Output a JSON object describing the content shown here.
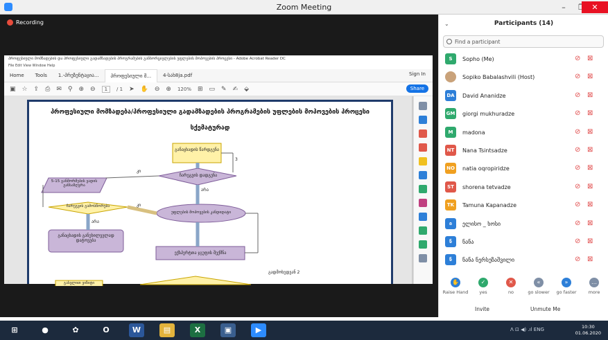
{
  "window": {
    "title": "Zoom Meeting",
    "minimize": "–",
    "maximize": "❐",
    "close": "✕"
  },
  "recording": {
    "label": "Recording"
  },
  "acrobat": {
    "title": "პროფესიული მომზადების და პროფესიული გადამზადების პროგრამების განხორციელების უფლების მოპოვების პროცესი - Adobe Acrobat Reader DC",
    "menu": "File  Edit  View  Window  Help",
    "tabs": [
      "Home",
      "Tools",
      "1.-პრეზენტაცია...",
      "პროფესიული მ...",
      "4-სახ8ja.pdf"
    ],
    "active_tab_index": 3,
    "sign_in": "Sign In",
    "page_current": "1",
    "page_total": "/ 1",
    "zoom": "120%",
    "share_label": "Share"
  },
  "document": {
    "heading_line1": "პროფესიული მომზადება/პროფესიული გადამზადების პროგრამების უფლების მოპოვების პროცესი",
    "heading_line2": "სქემატურად",
    "nodes": {
      "start": "განაცხადის წარდგენა",
      "check": "ჩარეგვის დადგენა",
      "missing": "5-15 განმორმების ვადის განსაზღვრა",
      "review": "ჩარეგვის გამოსწორება",
      "process": "უფლების მოპოვების კანდიდატი",
      "return": "განაცხადის განუხილველად დატოვება",
      "expert": "ექსპერტთა ჯგუფის შექმნა",
      "visit": "გასვლით ვიზიტი",
      "label_yes1": "კი",
      "label_no1": "არა",
      "label_yes2": "კი",
      "label_no2": "არა",
      "label_3": "3",
      "side_note": "გადმოხედვან 2"
    }
  },
  "participants": {
    "title": "Participants (14)",
    "search_placeholder": "Find a participant",
    "list": [
      {
        "initials": "S",
        "name": "Sopho (Me)",
        "color": "#2fa96d"
      },
      {
        "initials": "",
        "name": "Sopiko Babalashvili (Host)",
        "color": "#c9a27a"
      },
      {
        "initials": "DA",
        "name": "David Ananidze",
        "color": "#2d7fd8"
      },
      {
        "initials": "GM",
        "name": "giorgi mukhuradze",
        "color": "#2fa96d"
      },
      {
        "initials": "M",
        "name": "madona",
        "color": "#2fa96d"
      },
      {
        "initials": "NT",
        "name": "Nana Tsintsadze",
        "color": "#e0584a"
      },
      {
        "initials": "NO",
        "name": "natia oqropiridze",
        "color": "#f0a020"
      },
      {
        "initials": "ST",
        "name": "shorena tetvadze",
        "color": "#e0584a"
      },
      {
        "initials": "TK",
        "name": "Tamuna Kapanadze",
        "color": "#f0a020"
      },
      {
        "initials": "ი",
        "name": "ელისო _ ხოსი",
        "color": "#2d7fd8"
      },
      {
        "initials": "ნ",
        "name": "ნანა",
        "color": "#2d7fd8"
      },
      {
        "initials": "ნ",
        "name": "ნანა ნერსეზაშვილი",
        "color": "#2d7fd8"
      }
    ],
    "actions": [
      {
        "label": "Raise Hand",
        "icon": "raise-hand-icon",
        "color": "#2d7fd8",
        "glyph": "✋"
      },
      {
        "label": "yes",
        "icon": "yes-icon",
        "color": "#2fa96d",
        "glyph": "✓"
      },
      {
        "label": "no",
        "icon": "no-icon",
        "color": "#e0584a",
        "glyph": "✕"
      },
      {
        "label": "go slower",
        "icon": "go-slower-icon",
        "color": "#7f8fa6",
        "glyph": "«"
      },
      {
        "label": "go faster",
        "icon": "go-faster-icon",
        "color": "#2d7fd8",
        "glyph": "»"
      },
      {
        "label": "more",
        "icon": "more-icon",
        "color": "#7f8fa6",
        "glyph": "…"
      }
    ],
    "invite": "Invite",
    "unmute": "Unmute Me"
  },
  "taskbar": {
    "apps": [
      {
        "name": "windows-start-icon",
        "glyph": "⊞",
        "color": "#1c2a3d"
      },
      {
        "name": "chrome-icon",
        "glyph": "●",
        "color": "#1c2a3d"
      },
      {
        "name": "settings-app-icon",
        "glyph": "✿",
        "color": "#1c2a3d"
      },
      {
        "name": "opera-icon",
        "glyph": "O",
        "color": "#1c2a3d"
      },
      {
        "name": "word-icon",
        "glyph": "W",
        "color": "#2b579a"
      },
      {
        "name": "file-explorer-icon",
        "glyph": "▤",
        "color": "#e2b33c"
      },
      {
        "name": "excel-icon",
        "glyph": "X",
        "color": "#1d6f42"
      },
      {
        "name": "photos-icon",
        "glyph": "▣",
        "color": "#3a5f8f"
      },
      {
        "name": "zoom-taskbar-icon",
        "glyph": "▶",
        "color": "#2d8cff"
      }
    ],
    "time": "10:30",
    "date": "01.06.2020",
    "tray": "ᐱ  ⊡  ◀)  .ıl  ENG"
  }
}
